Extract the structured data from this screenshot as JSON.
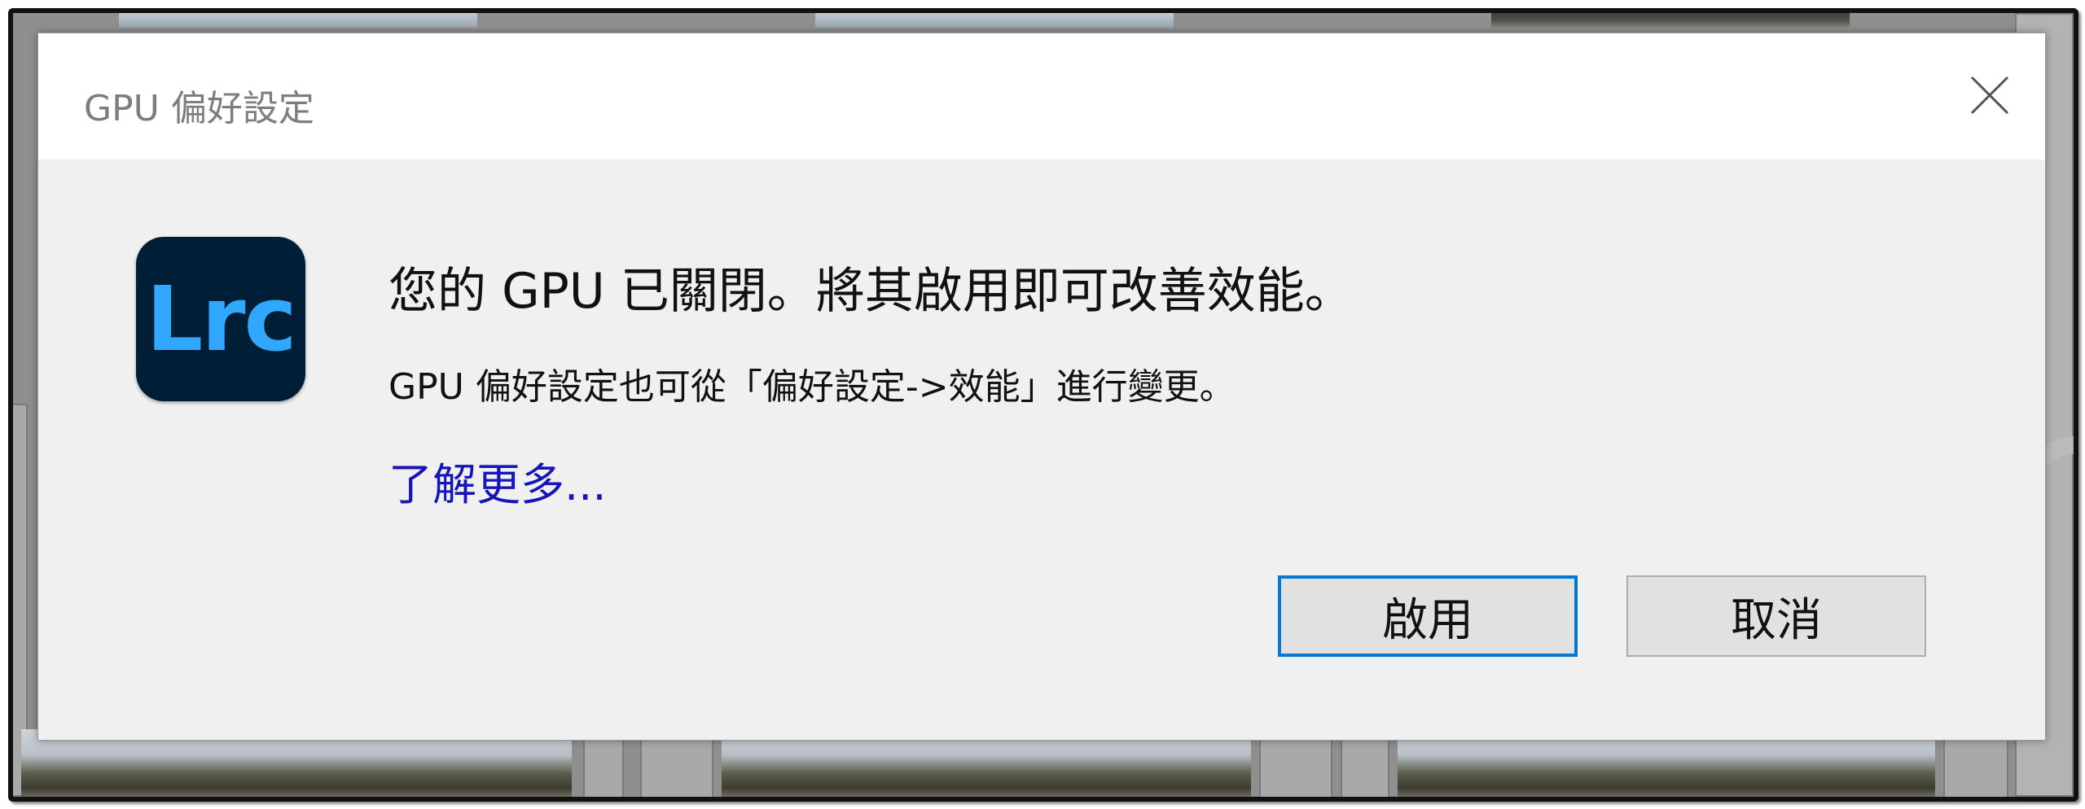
{
  "dialog": {
    "title": "GPU 偏好設定",
    "close_icon": "close-icon",
    "app_icon_label": "Lrc",
    "headline": "您的 GPU 已關閉。將其啟用即可改善效能。",
    "subline": "GPU 偏好設定也可從「偏好設定->效能」進行變更。",
    "learn_more_link": "了解更多...",
    "buttons": {
      "enable": "啟用",
      "cancel": "取消"
    }
  },
  "colors": {
    "icon_background": "#001e36",
    "icon_text": "#31a8ff",
    "link": "#1515b8",
    "primary_button_border": "#0078d7",
    "dialog_background": "#f0f0f0"
  }
}
